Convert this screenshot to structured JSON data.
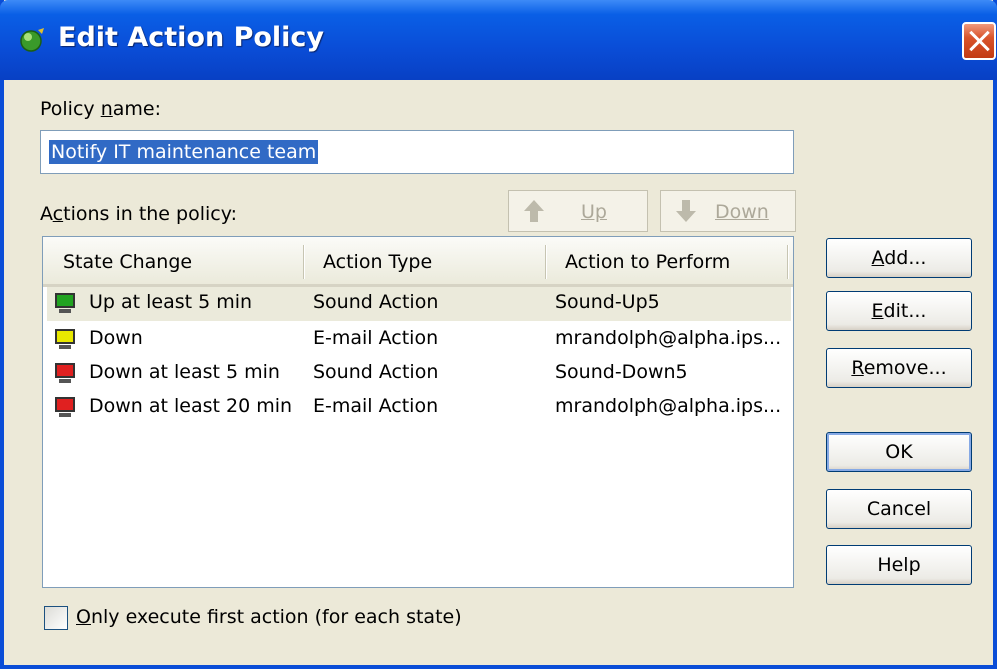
{
  "window": {
    "title": "Edit Action Policy"
  },
  "policy_name": {
    "label_pre": "Policy ",
    "label_key": "n",
    "label_post": "ame:",
    "value": "Notify IT maintenance team"
  },
  "actions_label": {
    "pre": "A",
    "key": "c",
    "post": "tions in the policy:"
  },
  "move_buttons": {
    "up": "Up",
    "down": "Down"
  },
  "table": {
    "columns": [
      "State Change",
      "Action Type",
      "Action to Perform"
    ],
    "rows": [
      {
        "state": "Up at least 5 min",
        "type": "Sound Action",
        "action": "Sound-Up5",
        "icon_color": "#21a321"
      },
      {
        "state": "Down",
        "type": "E-mail Action",
        "action": "mrandolph@alpha.ips...",
        "icon_color": "#e8e800"
      },
      {
        "state": "Down at least 5 min",
        "type": "Sound Action",
        "action": "Sound-Down5",
        "icon_color": "#e02020"
      },
      {
        "state": "Down at least 20 min",
        "type": "E-mail Action",
        "action": "mrandolph@alpha.ips...",
        "icon_color": "#e02020"
      }
    ]
  },
  "buttons": {
    "add": {
      "key": "A",
      "rest": "dd..."
    },
    "edit": {
      "key": "E",
      "rest": "dit..."
    },
    "remove": {
      "key": "R",
      "rest": "emove..."
    },
    "ok": "OK",
    "cancel": "Cancel",
    "help": "Help"
  },
  "checkbox": {
    "key": "O",
    "rest": "nly execute first action (for each state)",
    "checked": false
  }
}
